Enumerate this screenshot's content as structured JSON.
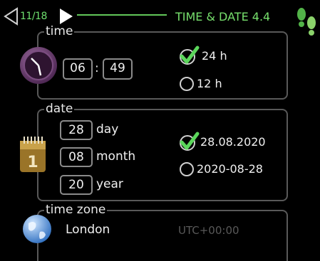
{
  "header": {
    "page_indicator": "11/18",
    "title": "TIME & DATE 4.4"
  },
  "time": {
    "label": "time",
    "hour": "06",
    "separator": ":",
    "minute": "49",
    "format_options": [
      {
        "label": "24 h",
        "selected": true
      },
      {
        "label": "12 h",
        "selected": false
      }
    ]
  },
  "date": {
    "label": "date",
    "day_value": "28",
    "day_unit": "day",
    "month_value": "08",
    "month_unit": "month",
    "year_value": "20",
    "year_unit": "year",
    "format_options": [
      {
        "label": "28.08.2020",
        "selected": true
      },
      {
        "label": "2020-08-28",
        "selected": false
      }
    ]
  },
  "time_zone": {
    "label": "time zone",
    "city": "London",
    "offset": "UTC+00:00"
  },
  "colors": {
    "accent_green": "#6ee06e",
    "frame_gray": "#595959",
    "clock_purple": "#6b3a6d",
    "calendar_gold": "#a8832c"
  },
  "icons": [
    "back-arrow-icon",
    "forward-arrow-icon",
    "footprints-icon",
    "clock-icon",
    "calendar-icon",
    "globe-icon",
    "check-icon",
    "radio-icon"
  ]
}
